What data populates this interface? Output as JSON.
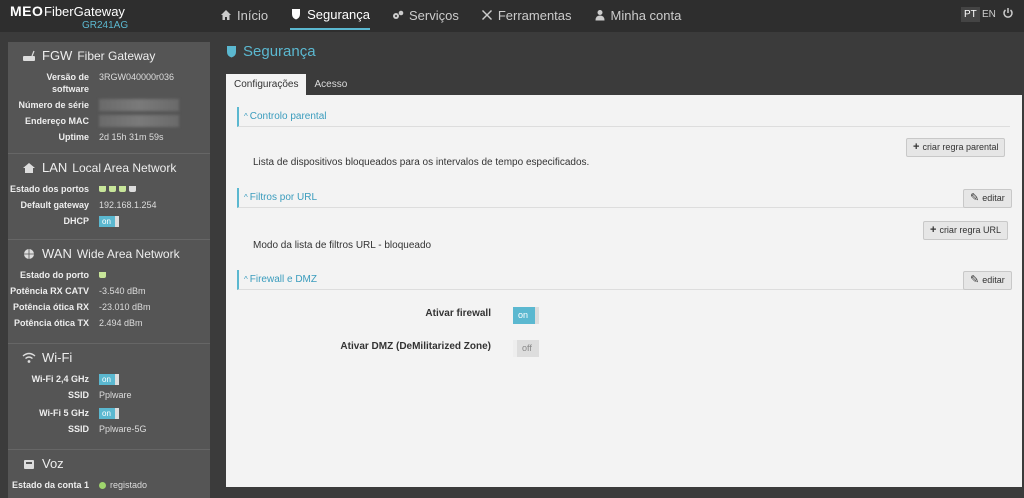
{
  "brand": {
    "meo": "MEO",
    "product": "FiberGateway",
    "model": "GR241AG"
  },
  "nav": [
    {
      "label": "Início",
      "icon": "home-icon"
    },
    {
      "label": "Segurança",
      "icon": "shield-icon"
    },
    {
      "label": "Serviços",
      "icon": "gears-icon"
    },
    {
      "label": "Ferramentas",
      "icon": "tools-icon"
    },
    {
      "label": "Minha conta",
      "icon": "user-icon"
    }
  ],
  "languages": [
    "PT",
    "EN"
  ],
  "sidebar": {
    "fgw": {
      "title_short": "FGW",
      "title": "Fiber Gateway",
      "version_label": "Versão de software",
      "version_value": "3RGW040000r036",
      "serial_label": "Número de série",
      "mac_label": "Endereço MAC",
      "uptime_label": "Uptime",
      "uptime_value": "2d 15h 31m 59s"
    },
    "lan": {
      "title_short": "LAN",
      "title": "Local Area Network",
      "ports_label": "Estado dos portos",
      "gateway_label": "Default gateway",
      "gateway_value": "192.168.1.254",
      "dhcp_label": "DHCP",
      "dhcp_value": "on"
    },
    "wan": {
      "title_short": "WAN",
      "title": "Wide Area Network",
      "port_label": "Estado do porto",
      "rx_catv_label": "Potência RX CATV",
      "rx_catv_value": "-3.540 dBm",
      "rx_label": "Potência ótica RX",
      "rx_value": "-23.010 dBm",
      "tx_label": "Potência ótica TX",
      "tx_value": "2.494 dBm"
    },
    "wifi": {
      "title": "Wi-Fi",
      "w24_label": "Wi-Fi 2,4 GHz",
      "w24_value": "on",
      "ssid_label": "SSID",
      "ssid24": "Pplware",
      "w5_label": "Wi-Fi 5 GHz",
      "w5_value": "on",
      "ssid5": "Pplware-5G"
    },
    "voz": {
      "title": "Voz",
      "account_label": "Estado da conta 1",
      "account_value": "registado"
    }
  },
  "main": {
    "title": "Segurança",
    "tabs": [
      "Configurações",
      "Acesso"
    ],
    "parental": {
      "header": "Controlo parental",
      "button": "criar regra parental",
      "desc": "Lista de dispositivos bloqueados para os intervalos de tempo especificados."
    },
    "url": {
      "header": "Filtros por URL",
      "edit": "editar",
      "button": "criar regra URL",
      "desc": "Modo da lista de filtros URL - bloqueado"
    },
    "firewall": {
      "header": "Firewall e DMZ",
      "edit": "editar",
      "fw_label": "Ativar firewall",
      "fw_value": "on",
      "dmz_label": "Ativar DMZ (DeMilitarized Zone)",
      "dmz_value": "off"
    }
  }
}
